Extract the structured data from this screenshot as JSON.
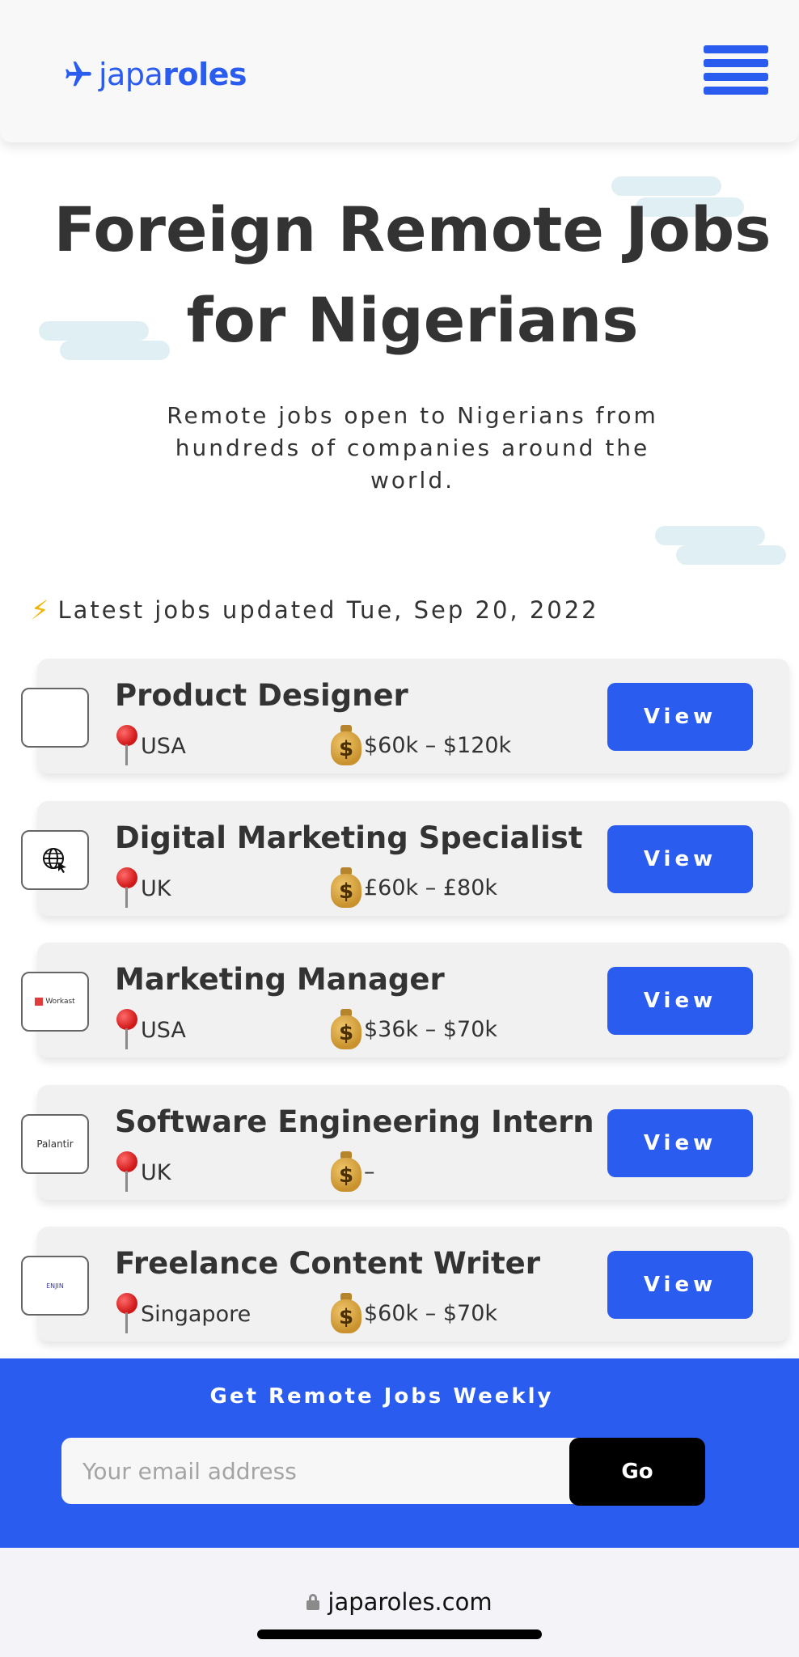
{
  "header": {
    "logo_regular": "japa",
    "logo_bold": "roles",
    "logo_icon": "airplane-icon",
    "menu_icon": "hamburger-menu-icon"
  },
  "hero": {
    "title_line1": "Foreign Remote Jobs",
    "title_line2": "for Nigerians",
    "subtitle": "Remote jobs open to Nigerians from hundreds of companies around the world."
  },
  "updated": {
    "icon": "⚡",
    "text": "Latest jobs updated Tue, Sep 20, 2022"
  },
  "jobs": [
    {
      "title": "Product Designer",
      "location": "USA",
      "salary": "$60k – $120k",
      "logo_text": "",
      "button": "View"
    },
    {
      "title": "Digital Marketing Specialist",
      "location": "UK",
      "salary": "£60k – £80k",
      "logo_text": "",
      "button": "View"
    },
    {
      "title": "Marketing Manager",
      "location": "USA",
      "salary": "$36k – $70k",
      "logo_text": "Workast",
      "button": "View"
    },
    {
      "title": "Software Engineering Intern",
      "location": "UK",
      "salary": "–",
      "logo_text": "Palantir",
      "button": "View"
    },
    {
      "title": "Freelance Content Writer",
      "location": "Singapore",
      "salary": "$60k – $70k",
      "logo_text": "ENJIN",
      "button": "View"
    }
  ],
  "newsletter": {
    "title": "Get Remote Jobs Weekly",
    "placeholder": "Your email address",
    "button": "Go"
  },
  "browser": {
    "url": "japaroles.com"
  },
  "colors": {
    "brand_blue": "#2b5cf0",
    "text_dark": "#333333",
    "card_bg": "#f1f1f1"
  }
}
